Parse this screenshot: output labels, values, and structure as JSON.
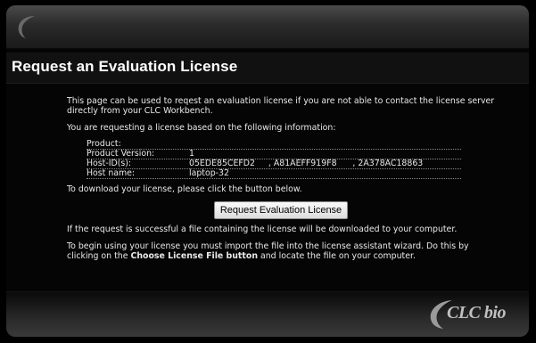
{
  "header": {
    "title": "Request an Evaluation License"
  },
  "content": {
    "intro": "This page can be used to reqest an evaluation license if you are not able to contact the license server directly from your CLC Workbench.",
    "based_on": "You are requesting a license based on the following information:",
    "info": [
      {
        "label": "Product:",
        "value": ""
      },
      {
        "label": "Product Version:",
        "value": "1"
      },
      {
        "label": "Host-ID(s):",
        "value": "05EDE85CEFD2     , A81AEFF919F8      , 2A378AC18863"
      },
      {
        "label": "Host name:",
        "value": "laptop-32"
      }
    ],
    "download_prompt": "To download your license, please click the button below.",
    "button_label": "Request Evaluation License",
    "success_note": "If the request is successful a file containing the license will be downloaded to your computer.",
    "instructions_1": "To begin using your license you must import the file into the license assistant wizard. Do this by clicking on the",
    "instructions_bold": "Choose License File button",
    "instructions_2": "and locate the file on your computer."
  },
  "footer": {
    "logo_text": "CLC bio"
  }
}
